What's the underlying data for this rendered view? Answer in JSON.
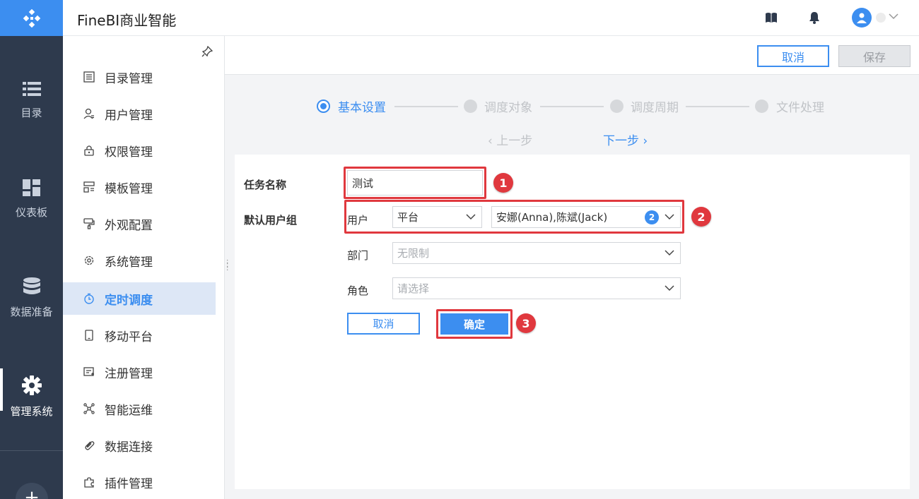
{
  "app": {
    "title": "FineBI商业智能"
  },
  "rail": {
    "items": [
      {
        "label": "目录",
        "icon": "list-icon"
      },
      {
        "label": "仪表板",
        "icon": "dashboard-icon"
      },
      {
        "label": "数据准备",
        "icon": "database-icon"
      },
      {
        "label": "管理系统",
        "icon": "gear-icon",
        "active": true
      }
    ]
  },
  "sidebar": {
    "items": [
      {
        "label": "目录管理",
        "icon": "catalog-icon"
      },
      {
        "label": "用户管理",
        "icon": "user-icon"
      },
      {
        "label": "权限管理",
        "icon": "lock-icon"
      },
      {
        "label": "模板管理",
        "icon": "template-icon"
      },
      {
        "label": "外观配置",
        "icon": "paint-icon"
      },
      {
        "label": "系统管理",
        "icon": "settings-icon"
      },
      {
        "label": "定时调度",
        "icon": "timer-icon",
        "active": true
      },
      {
        "label": "移动平台",
        "icon": "mobile-icon"
      },
      {
        "label": "注册管理",
        "icon": "register-icon"
      },
      {
        "label": "智能运维",
        "icon": "ops-icon"
      },
      {
        "label": "数据连接",
        "icon": "link-icon"
      },
      {
        "label": "插件管理",
        "icon": "plugin-icon"
      }
    ]
  },
  "toolbar": {
    "cancel_label": "取消",
    "save_label": "保存"
  },
  "steps": {
    "items": [
      {
        "label": "基本设置",
        "active": true
      },
      {
        "label": "调度对象"
      },
      {
        "label": "调度周期"
      },
      {
        "label": "文件处理"
      }
    ],
    "prev_label": "上一步",
    "next_label": "下一步"
  },
  "form": {
    "task_name_label": "任务名称",
    "task_name_value": "测试",
    "user_group_label": "默认用户组",
    "user_label": "用户",
    "platform_value": "平台",
    "users_value": "安娜(Anna),陈斌(Jack)",
    "users_count": "2",
    "dept_label": "部门",
    "dept_value": "无限制",
    "role_label": "角色",
    "role_placeholder": "请选择",
    "cancel_label": "取消",
    "confirm_label": "确定"
  },
  "markers": [
    "1",
    "2",
    "3"
  ],
  "colors": {
    "accent": "#3c8ef0",
    "highlight": "#e0383e",
    "rail": "#2e3a4d"
  }
}
